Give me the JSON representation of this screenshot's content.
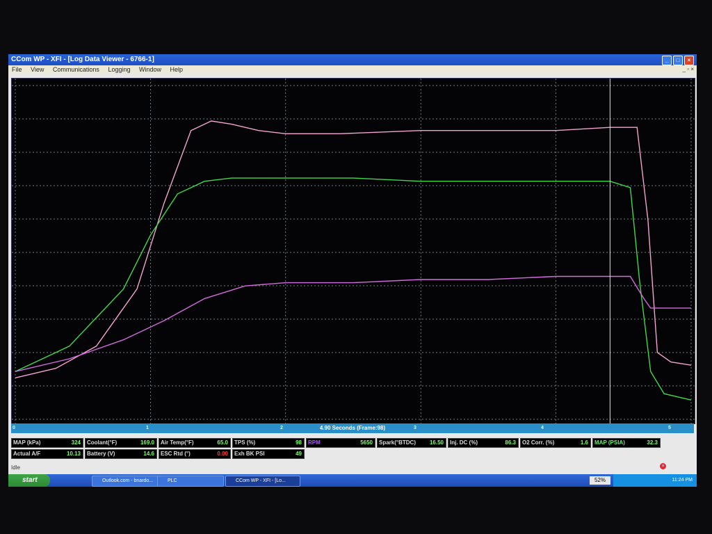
{
  "window": {
    "title": "CCom WP - XFI - [Log Data Viewer - 6766-1]",
    "controls": [
      "_",
      "□",
      "×"
    ]
  },
  "menu": {
    "items": [
      "File",
      "View",
      "Communications",
      "Logging",
      "Window",
      "Help"
    ],
    "mdi_controls": "_ ▫ ×"
  },
  "timebar": {
    "label": "4.90 Seconds (Frame:98)",
    "ticks": [
      "0",
      "1",
      "2",
      "3",
      "4",
      "5"
    ]
  },
  "gauges": [
    {
      "label": "MAP (kPa)",
      "value": "324",
      "label_color": "#dddddd",
      "value_color": "#7dff6a"
    },
    {
      "label": "Coolant(°F)",
      "value": "169.0",
      "label_color": "#dddddd",
      "value_color": "#7dff6a"
    },
    {
      "label": "Air Temp(°F)",
      "value": "65.0",
      "label_color": "#dddddd",
      "value_color": "#7dff6a"
    },
    {
      "label": "TPS (%)",
      "value": "98",
      "label_color": "#dddddd",
      "value_color": "#7dff6a"
    },
    {
      "label": "RPM",
      "value": "5650",
      "label_color": "#b055ff",
      "value_color": "#7dff6a"
    },
    {
      "label": "Spark(°BTDC)",
      "value": "16.50",
      "label_color": "#dddddd",
      "value_color": "#7dff6a"
    },
    {
      "label": "Inj. DC (%)",
      "value": "86.3",
      "label_color": "#dddddd",
      "value_color": "#7dff6a"
    },
    {
      "label": "O2 Corr. (%)",
      "value": "1.6",
      "label_color": "#dddddd",
      "value_color": "#7dff6a"
    },
    {
      "label": "MAP (PSIA)",
      "value": "32.3",
      "label_color": "#6cf06c",
      "value_color": "#7dff6a"
    },
    {
      "label": "Actual A/F",
      "value": "10.13",
      "label_color": "#dddddd",
      "value_color": "#7dff6a"
    },
    {
      "label": "Battery (V)",
      "value": "14.6",
      "label_color": "#dddddd",
      "value_color": "#7dff6a"
    },
    {
      "label": "ESC Rtd (°)",
      "value": "0.00",
      "label_color": "#dddddd",
      "value_color": "#ff3b3b"
    },
    {
      "label": "Exh BK PSI",
      "value": "49",
      "label_color": "#dddddd",
      "value_color": "#7dff6a"
    }
  ],
  "status": {
    "text": "Idle"
  },
  "taskbar": {
    "start_label": "start",
    "tasks": [
      "Outlook.com - bnardo...",
      "PLC",
      "CCom WP - XFI - [Lo..."
    ],
    "battery": "52%",
    "clock": "11:24 PM"
  },
  "colors": {
    "trace_pink": "#f4a3d0",
    "trace_green": "#3fd94a",
    "trace_magenta": "#d46be0",
    "cursor": "#e6e6c8"
  },
  "chart_data": {
    "type": "line",
    "x_range": [
      0,
      5
    ],
    "grid": true,
    "cursor_x": 4.4,
    "series": [
      {
        "x": [
          0,
          0.3,
          0.6,
          0.9,
          1.1,
          1.3,
          1.45,
          1.6,
          1.8,
          2.0,
          2.4,
          3.0,
          3.5,
          4.0,
          4.4,
          4.6,
          4.68,
          4.75,
          4.85,
          5.0
        ],
        "values": [
          10,
          13,
          20,
          38,
          65,
          88,
          91,
          90,
          88,
          87,
          87,
          88,
          88,
          88,
          89,
          89,
          60,
          18,
          15,
          14
        ]
      },
      {
        "x": [
          0,
          0.4,
          0.8,
          1.0,
          1.2,
          1.4,
          1.6,
          2.0,
          2.5,
          3.0,
          3.5,
          4.0,
          4.4,
          4.55,
          4.62,
          4.7,
          4.8,
          5.0
        ],
        "values": [
          12,
          20,
          38,
          55,
          68,
          72,
          73,
          73,
          73,
          72,
          72,
          72,
          72,
          70,
          40,
          12,
          5,
          3
        ]
      },
      {
        "x": [
          0,
          0.4,
          0.8,
          1.1,
          1.4,
          1.7,
          2.0,
          2.5,
          3.0,
          3.5,
          4.0,
          4.4,
          4.55,
          4.65,
          4.7,
          5.0
        ],
        "values": [
          12,
          16,
          22,
          28,
          35,
          39,
          40,
          40,
          41,
          41,
          42,
          42,
          42,
          35,
          32,
          32
        ]
      }
    ]
  }
}
